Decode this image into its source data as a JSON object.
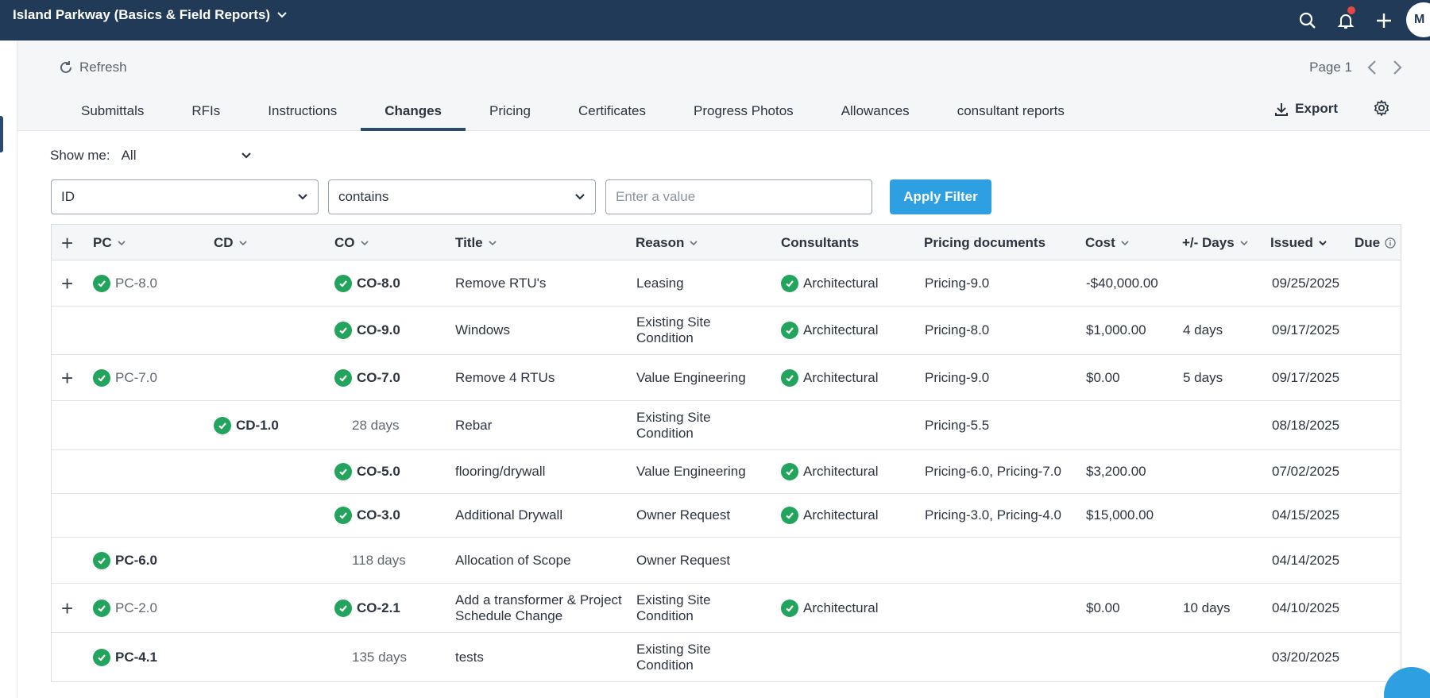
{
  "topbar": {
    "project_title": "Island Parkway (Basics & Field Reports)",
    "avatar_initial": "M"
  },
  "toolbar": {
    "refresh_label": "Refresh",
    "page_label": "Page 1",
    "export_label": "Export"
  },
  "tabs": [
    {
      "label": "Submittals"
    },
    {
      "label": "RFIs"
    },
    {
      "label": "Instructions"
    },
    {
      "label": "Changes",
      "active": true
    },
    {
      "label": "Pricing"
    },
    {
      "label": "Certificates"
    },
    {
      "label": "Progress Photos"
    },
    {
      "label": "Allowances"
    },
    {
      "label": "consultant reports"
    }
  ],
  "filter": {
    "show_me_label": "Show me:",
    "show_me_value": "All",
    "field_value": "ID",
    "operator_value": "contains",
    "value_placeholder": "Enter a value",
    "apply_label": "Apply Filter"
  },
  "table": {
    "headers": {
      "pc": "PC",
      "cd": "CD",
      "co": "CO",
      "title": "Title",
      "reason": "Reason",
      "consultants": "Consultants",
      "pricing_docs": "Pricing documents",
      "cost": "Cost",
      "days": "+/- Days",
      "issued": "Issued",
      "due": "Due"
    },
    "rows": [
      {
        "expand": true,
        "pc": "PC-8.0",
        "cd": "",
        "co": "CO-8.0",
        "title": "Remove RTU's",
        "reason": "Leasing",
        "consultants": "Architectural",
        "pricing": "Pricing-9.0",
        "cost": "-$40,000.00",
        "days": "",
        "issued": "09/25/2025"
      },
      {
        "expand": false,
        "pc": "",
        "cd": "",
        "co": "CO-9.0",
        "title": "Windows",
        "reason": "Existing Site Condition",
        "consultants": "Architectural",
        "pricing": "Pricing-8.0",
        "cost": "$1,000.00",
        "days": "4 days",
        "issued": "09/17/2025"
      },
      {
        "expand": true,
        "pc": "PC-7.0",
        "cd": "",
        "co": "CO-7.0",
        "title": "Remove 4 RTUs",
        "reason": "Value Engineering",
        "consultants": "Architectural",
        "pricing": "Pricing-9.0",
        "cost": "$0.00",
        "days": "5 days",
        "issued": "09/17/2025"
      },
      {
        "expand": false,
        "pc": "",
        "cd": "CD-1.0",
        "co": "28 days",
        "title": "Rebar",
        "reason": "Existing Site Condition",
        "consultants": "",
        "pricing": "Pricing-5.5",
        "cost": "",
        "days": "",
        "issued": "08/18/2025"
      },
      {
        "expand": false,
        "pc": "",
        "cd": "",
        "co": "CO-5.0",
        "title": "flooring/drywall",
        "reason": "Value Engineering",
        "consultants": "Architectural",
        "pricing": "Pricing-6.0, Pricing-7.0",
        "cost": "$3,200.00",
        "days": "",
        "issued": "07/02/2025"
      },
      {
        "expand": false,
        "pc": "",
        "cd": "",
        "co": "CO-3.0",
        "title": "Additional Drywall",
        "reason": "Owner Request",
        "consultants": "Architectural",
        "pricing": "Pricing-3.0, Pricing-4.0",
        "cost": "$15,000.00",
        "days": "",
        "issued": "04/15/2025"
      },
      {
        "expand": false,
        "pc": "PC-6.0",
        "cd": "",
        "co": "118 days",
        "title": "Allocation of Scope",
        "reason": "Owner Request",
        "consultants": "",
        "pricing": "",
        "cost": "",
        "days": "",
        "issued": "04/14/2025"
      },
      {
        "expand": true,
        "pc": "PC-2.0",
        "cd": "",
        "co": "CO-2.1",
        "title": "Add a transformer & Project Schedule Change",
        "reason": "Existing Site Condition",
        "consultants": "Architectural",
        "pricing": "",
        "cost": "$0.00",
        "days": "10 days",
        "issued": "04/10/2025"
      },
      {
        "expand": false,
        "pc": "PC-4.1",
        "cd": "",
        "co": "135 days",
        "title": "tests",
        "reason": "Existing Site Condition",
        "consultants": "",
        "pricing": "",
        "cost": "",
        "days": "",
        "issued": "03/20/2025"
      }
    ]
  },
  "colors": {
    "topbar": "#203a57",
    "accent": "#2e9fe0",
    "check": "#22a45d",
    "notification": "#e54646"
  }
}
